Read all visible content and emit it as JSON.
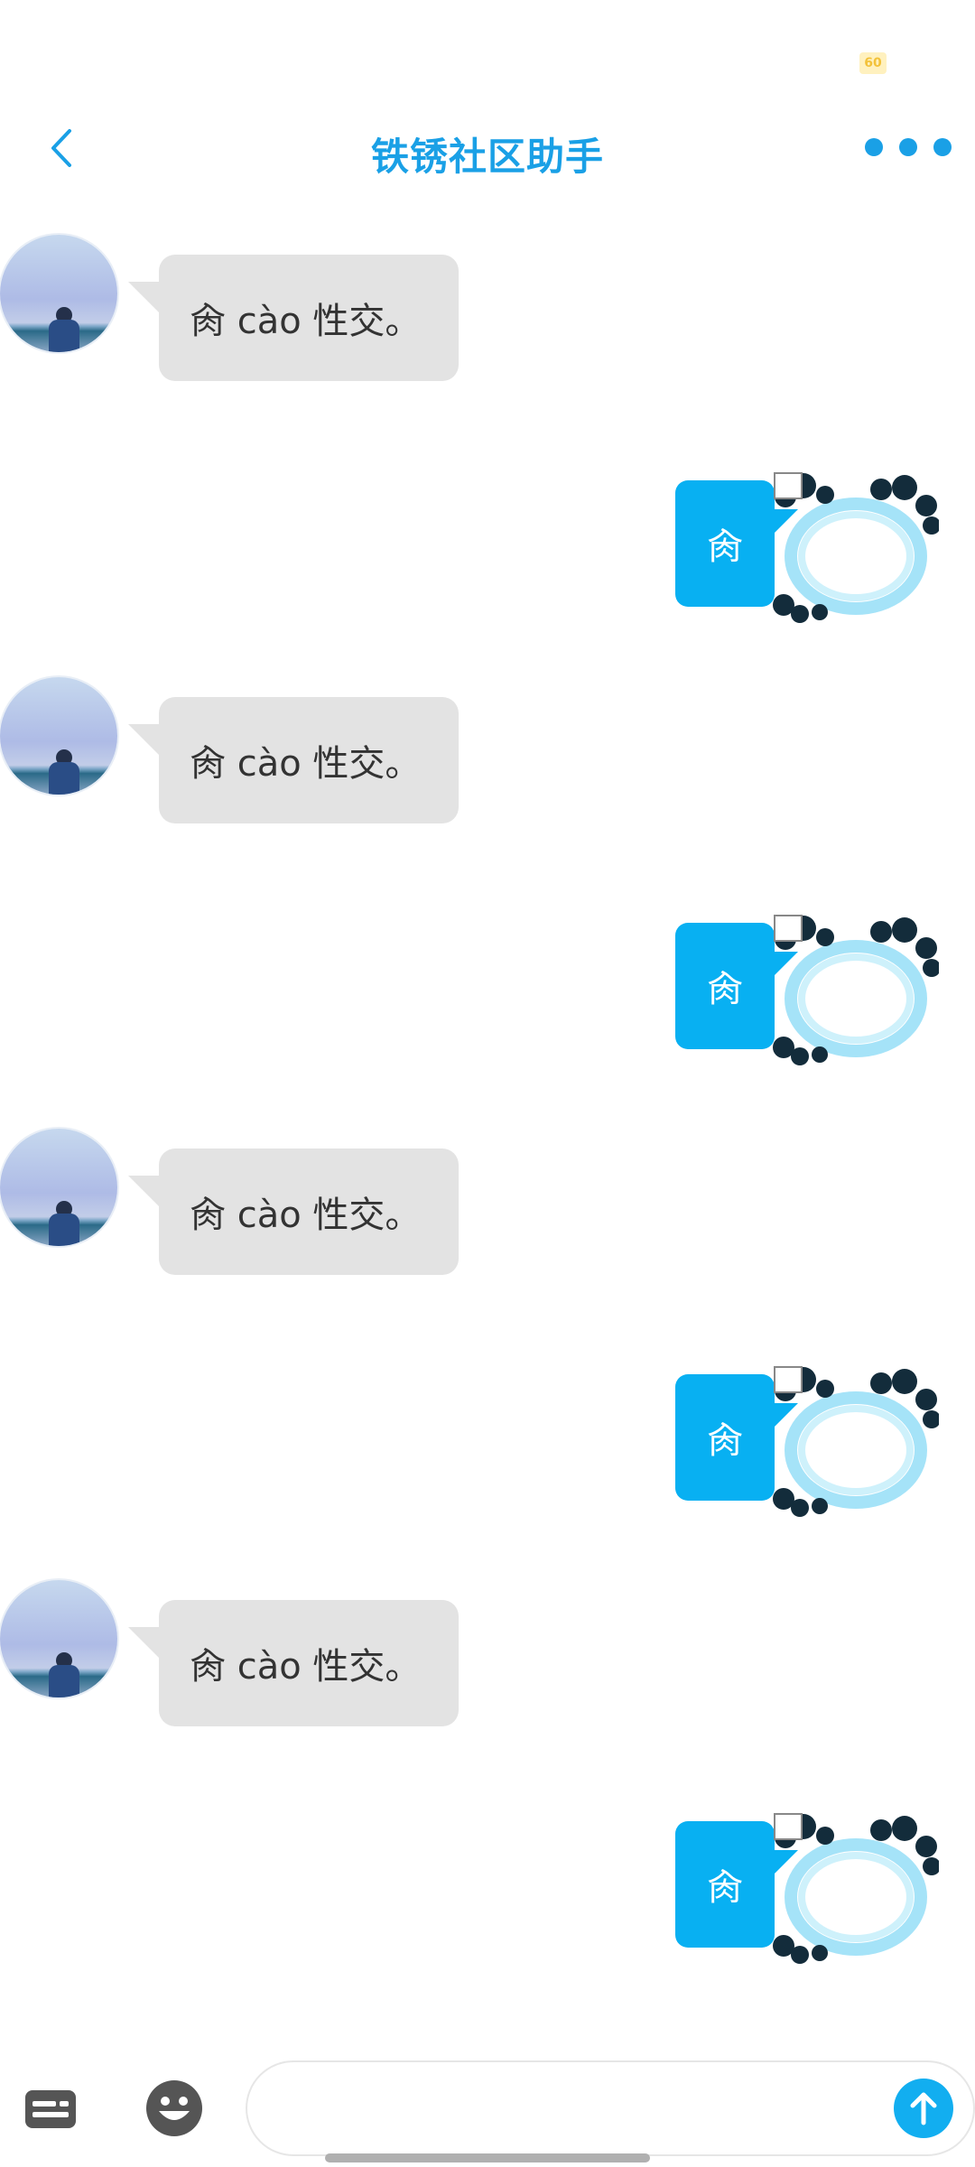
{
  "status_bar": {
    "battery_label": "60"
  },
  "header": {
    "back_icon": "chevron-left-icon",
    "title": "铁锈社区助手",
    "more_icon": "more-dots-icon",
    "accent_color": "#1aa0e6"
  },
  "messages": [
    {
      "side": "left",
      "text": "肏 cào 性交。"
    },
    {
      "side": "right",
      "text": "肏"
    },
    {
      "side": "left",
      "text": "肏 cào 性交。"
    },
    {
      "side": "right",
      "text": "肏"
    },
    {
      "side": "left",
      "text": "肏 cào 性交。"
    },
    {
      "side": "right",
      "text": "肏"
    },
    {
      "side": "left",
      "text": "肏 cào 性交。"
    },
    {
      "side": "right",
      "text": "肏"
    }
  ],
  "bottom_bar": {
    "keyboard_icon": "keyboard-icon",
    "emoji_icon": "emoji-icon",
    "input_value": "",
    "send_icon": "send-arrow-icon"
  },
  "colors": {
    "bubble_left": "#e3e3e3",
    "bubble_right": "#08b0f2",
    "send_button": "#12aef0"
  }
}
